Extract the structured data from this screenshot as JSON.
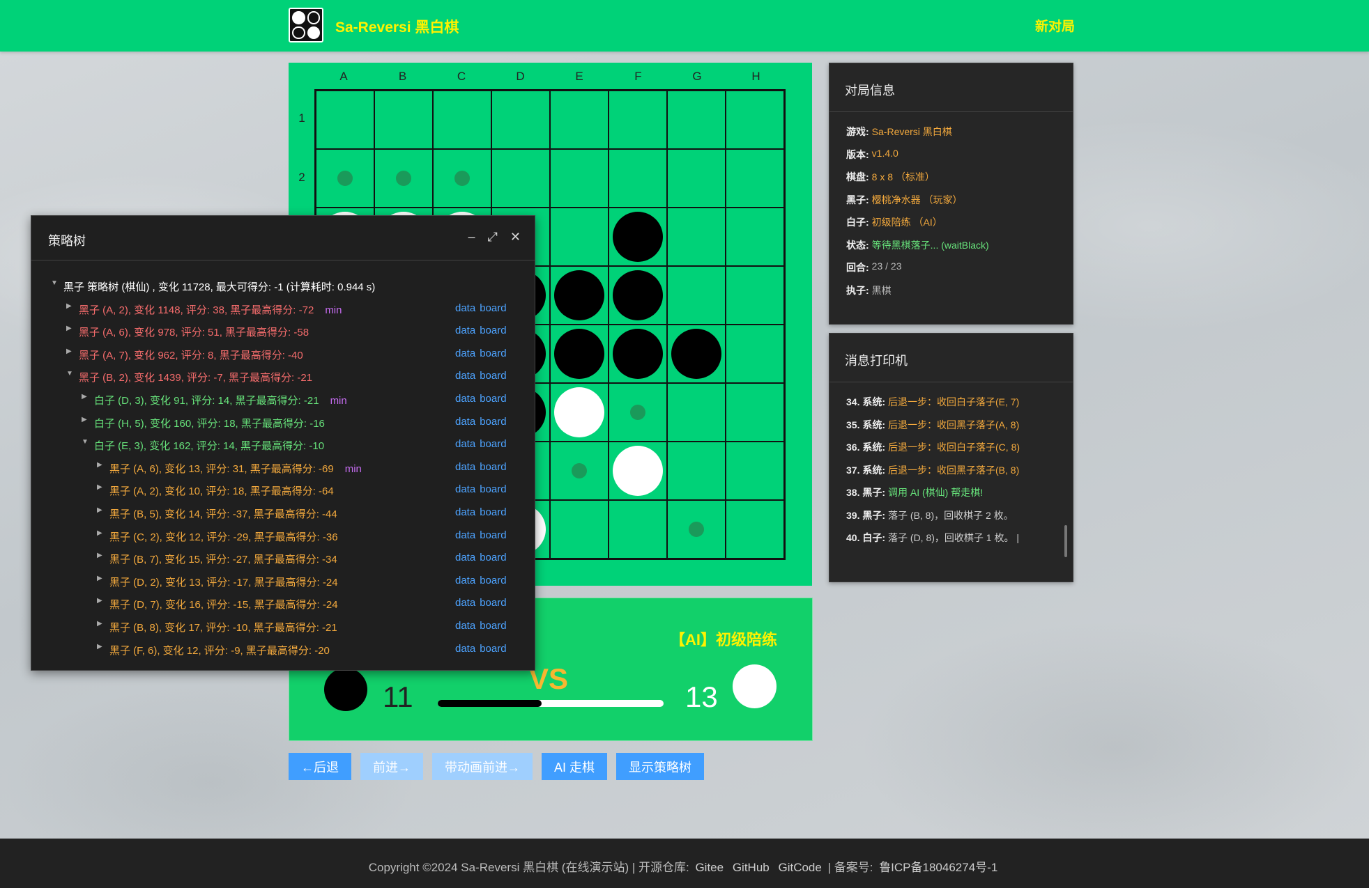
{
  "header": {
    "brand": "Sa-Reversi 黑白棋",
    "new_game": "新对局"
  },
  "board": {
    "columns": [
      "A",
      "B",
      "C",
      "D",
      "E",
      "F",
      "G",
      "H"
    ],
    "rows": [
      "1",
      "2"
    ],
    "cells": [
      [
        "",
        "",
        "",
        "",
        "",
        "",
        "",
        ""
      ],
      [
        "hint",
        "hint",
        "hint",
        "",
        "",
        "",
        "",
        ""
      ],
      [
        "white",
        "white",
        "white",
        "",
        "",
        "black",
        "",
        ""
      ],
      [
        "",
        "",
        "",
        "black",
        "black",
        "black",
        "",
        ""
      ],
      [
        "",
        "",
        "",
        "black",
        "black",
        "black",
        "black",
        ""
      ],
      [
        "",
        "",
        "",
        "black",
        "white",
        "hint",
        "",
        ""
      ],
      [
        "",
        "",
        "",
        "",
        "hint",
        "white",
        "",
        ""
      ],
      [
        "",
        "",
        "",
        "white",
        "",
        "",
        "hint",
        ""
      ]
    ]
  },
  "score": {
    "ai_name": "【AI】初级陪练",
    "black_count": "11",
    "white_count": "13",
    "vs": "VS",
    "black_fraction": 0.46
  },
  "buttons": {
    "back": "←后退",
    "forward": "前进→",
    "anim_forward": "带动画前进→",
    "ai_move": "AI 走棋",
    "show_tree": "显示策略树"
  },
  "info_panel": {
    "title": "对局信息",
    "rows": [
      {
        "k": "游戏:",
        "v": "Sa-Reversi 黑白棋"
      },
      {
        "k": "版本:",
        "v": "v1.4.0"
      },
      {
        "k": "棋盘:",
        "v": "8 x 8 （标准）"
      },
      {
        "k": "黑子:",
        "v": "樱桃净水器 （玩家）"
      },
      {
        "k": "白子:",
        "v": "初级陪练 （AI）"
      },
      {
        "k": "状态:",
        "v": "等待黑棋落子... (waitBlack)"
      },
      {
        "k": "回合:",
        "v": "23 / 23"
      },
      {
        "k": "执子:",
        "v": "黑棋"
      }
    ]
  },
  "msg_panel": {
    "title": "消息打印机",
    "rows": [
      {
        "k": "34. 系统:",
        "v": "后退一步：收回白子落子(E, 7)"
      },
      {
        "k": "35. 系统:",
        "v": "后退一步：收回黑子落子(A, 8)"
      },
      {
        "k": "36. 系统:",
        "v": "后退一步：收回白子落子(C, 8)"
      },
      {
        "k": "37. 系统:",
        "v": "后退一步：收回黑子落子(B, 8)"
      },
      {
        "k": "38. 黑子:",
        "v": "调用 AI (棋仙) 帮走棋!"
      },
      {
        "k": "39. 黑子:",
        "v": "落子 (B, 8)，回收棋子 2 枚。"
      },
      {
        "k": "40. 白子:",
        "v": "落子 (D, 8)，回收棋子 1 枚。 |"
      }
    ]
  },
  "tree": {
    "title": "策略树",
    "ctrl_minimize": "–",
    "ctrl_maximize": "⤢",
    "ctrl_close": "✕",
    "link_data": "data",
    "link_board": "board",
    "min_tag": "min",
    "rows": [
      {
        "text": "黑子 策略树 (棋仙) , 变化 11728, 最大可得分: -1 (计算耗时: 0.944 s)",
        "color": "root",
        "indent": 0,
        "open": true,
        "min": false,
        "links": false
      },
      {
        "text": "黑子 (A, 2), 变化 1148, 评分: 38, 黑子最高得分: -72",
        "color": "red",
        "indent": 1,
        "open": false,
        "min": true,
        "links": true
      },
      {
        "text": "黑子 (A, 6), 变化 978, 评分: 51, 黑子最高得分: -58",
        "color": "red",
        "indent": 1,
        "open": false,
        "min": false,
        "links": true
      },
      {
        "text": "黑子 (A, 7), 变化 962, 评分: 8, 黑子最高得分: -40",
        "color": "red",
        "indent": 1,
        "open": false,
        "min": false,
        "links": true
      },
      {
        "text": "黑子 (B, 2), 变化 1439, 评分: -7, 黑子最高得分: -21",
        "color": "red",
        "indent": 1,
        "open": true,
        "min": false,
        "links": true
      },
      {
        "text": "白子 (D, 3), 变化 91, 评分: 14, 黑子最高得分: -21",
        "color": "green",
        "indent": 2,
        "open": false,
        "min": true,
        "links": true
      },
      {
        "text": "白子 (H, 5), 变化 160, 评分: 18, 黑子最高得分: -16",
        "color": "green",
        "indent": 2,
        "open": false,
        "min": false,
        "links": true
      },
      {
        "text": "白子 (E, 3), 变化 162, 评分: 14, 黑子最高得分: -10",
        "color": "green",
        "indent": 2,
        "open": true,
        "min": false,
        "links": true
      },
      {
        "text": "黑子 (A, 6), 变化 13, 评分: 31, 黑子最高得分: -69",
        "color": "orange",
        "indent": 3,
        "open": false,
        "min": true,
        "links": true
      },
      {
        "text": "黑子 (A, 2), 变化 10, 评分: 18, 黑子最高得分: -64",
        "color": "orange",
        "indent": 3,
        "open": false,
        "min": false,
        "links": true
      },
      {
        "text": "黑子 (B, 5), 变化 14, 评分: -37, 黑子最高得分: -44",
        "color": "orange",
        "indent": 3,
        "open": false,
        "min": false,
        "links": true
      },
      {
        "text": "黑子 (C, 2), 变化 12, 评分: -29, 黑子最高得分: -36",
        "color": "orange",
        "indent": 3,
        "open": false,
        "min": false,
        "links": true
      },
      {
        "text": "黑子 (B, 7), 变化 15, 评分: -27, 黑子最高得分: -34",
        "color": "orange",
        "indent": 3,
        "open": false,
        "min": false,
        "links": true
      },
      {
        "text": "黑子 (D, 2), 变化 13, 评分: -17, 黑子最高得分: -24",
        "color": "orange",
        "indent": 3,
        "open": false,
        "min": false,
        "links": true
      },
      {
        "text": "黑子 (D, 7), 变化 16, 评分: -15, 黑子最高得分: -24",
        "color": "orange",
        "indent": 3,
        "open": false,
        "min": false,
        "links": true
      },
      {
        "text": "黑子 (B, 8), 变化 17, 评分: -10, 黑子最高得分: -21",
        "color": "orange",
        "indent": 3,
        "open": false,
        "min": false,
        "links": true
      },
      {
        "text": "黑子 (F, 6), 变化 12, 评分: -9, 黑子最高得分: -20",
        "color": "orange",
        "indent": 3,
        "open": false,
        "min": false,
        "links": true
      }
    ]
  },
  "footer": {
    "copyright": "Copyright ©2024 Sa-Reversi 黑白棋 (在线演示站) | 开源仓库:",
    "gitee": "Gitee",
    "github": "GitHub",
    "gitcode": "GitCode",
    "icp_label": "| 备案号:",
    "icp": "鲁ICP备18046274号-1"
  }
}
